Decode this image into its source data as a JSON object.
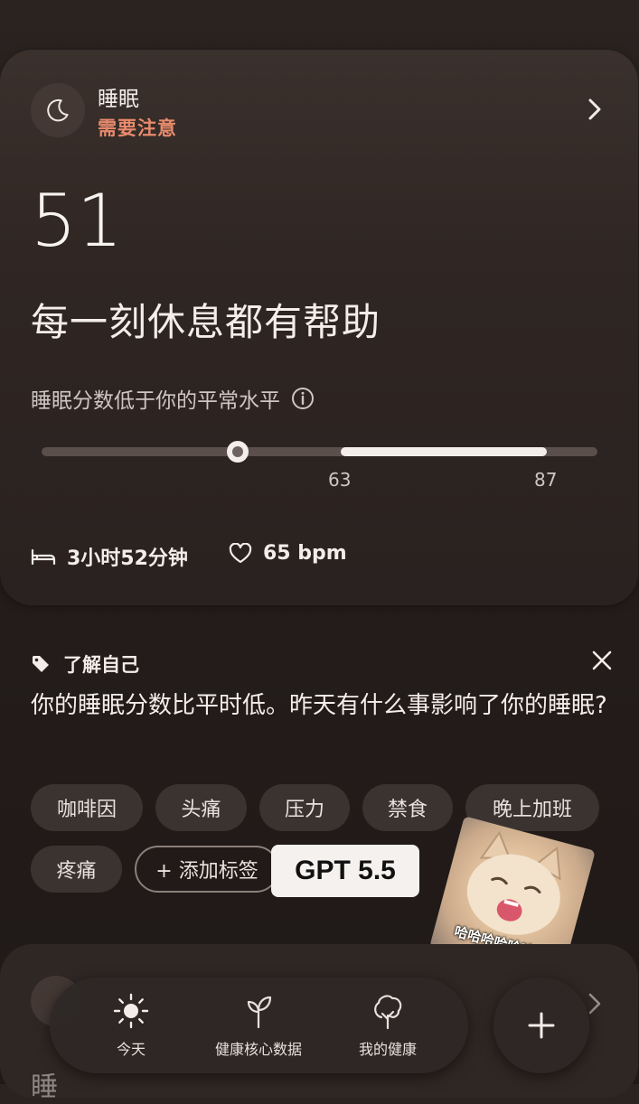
{
  "sleep_card": {
    "title": "睡眠",
    "status": "需要注意",
    "score": "51",
    "headline": "每一刻休息都有帮助",
    "subtitle": "睡眠分数低于你的平常水平",
    "score_value": 51,
    "usual_range": [
      63,
      87
    ],
    "range_low_label": "63",
    "range_high_label": "87",
    "duration": "3小时52分钟",
    "heart_rate": "65 bpm",
    "status_color": "#e88a6c"
  },
  "insight": {
    "label": "了解自己",
    "question": "你的睡眠分数比平时低。昨天有什么事影响了你的睡眠?",
    "tags": [
      "咖啡因",
      "头痛",
      "压力",
      "禁食",
      "晚上加班",
      "疼痛"
    ],
    "add_tag": "+ 添加标签"
  },
  "overlay": {
    "badge": "GPT 5.5",
    "meme_caption": "哈哈哈哈哈哈哈"
  },
  "next_card_partial": "睡",
  "nav": {
    "items": [
      {
        "label": "今天",
        "icon": "sun-icon"
      },
      {
        "label": "健康核心数据",
        "icon": "sprout-icon"
      },
      {
        "label": "我的健康",
        "icon": "tree-icon"
      }
    ]
  }
}
